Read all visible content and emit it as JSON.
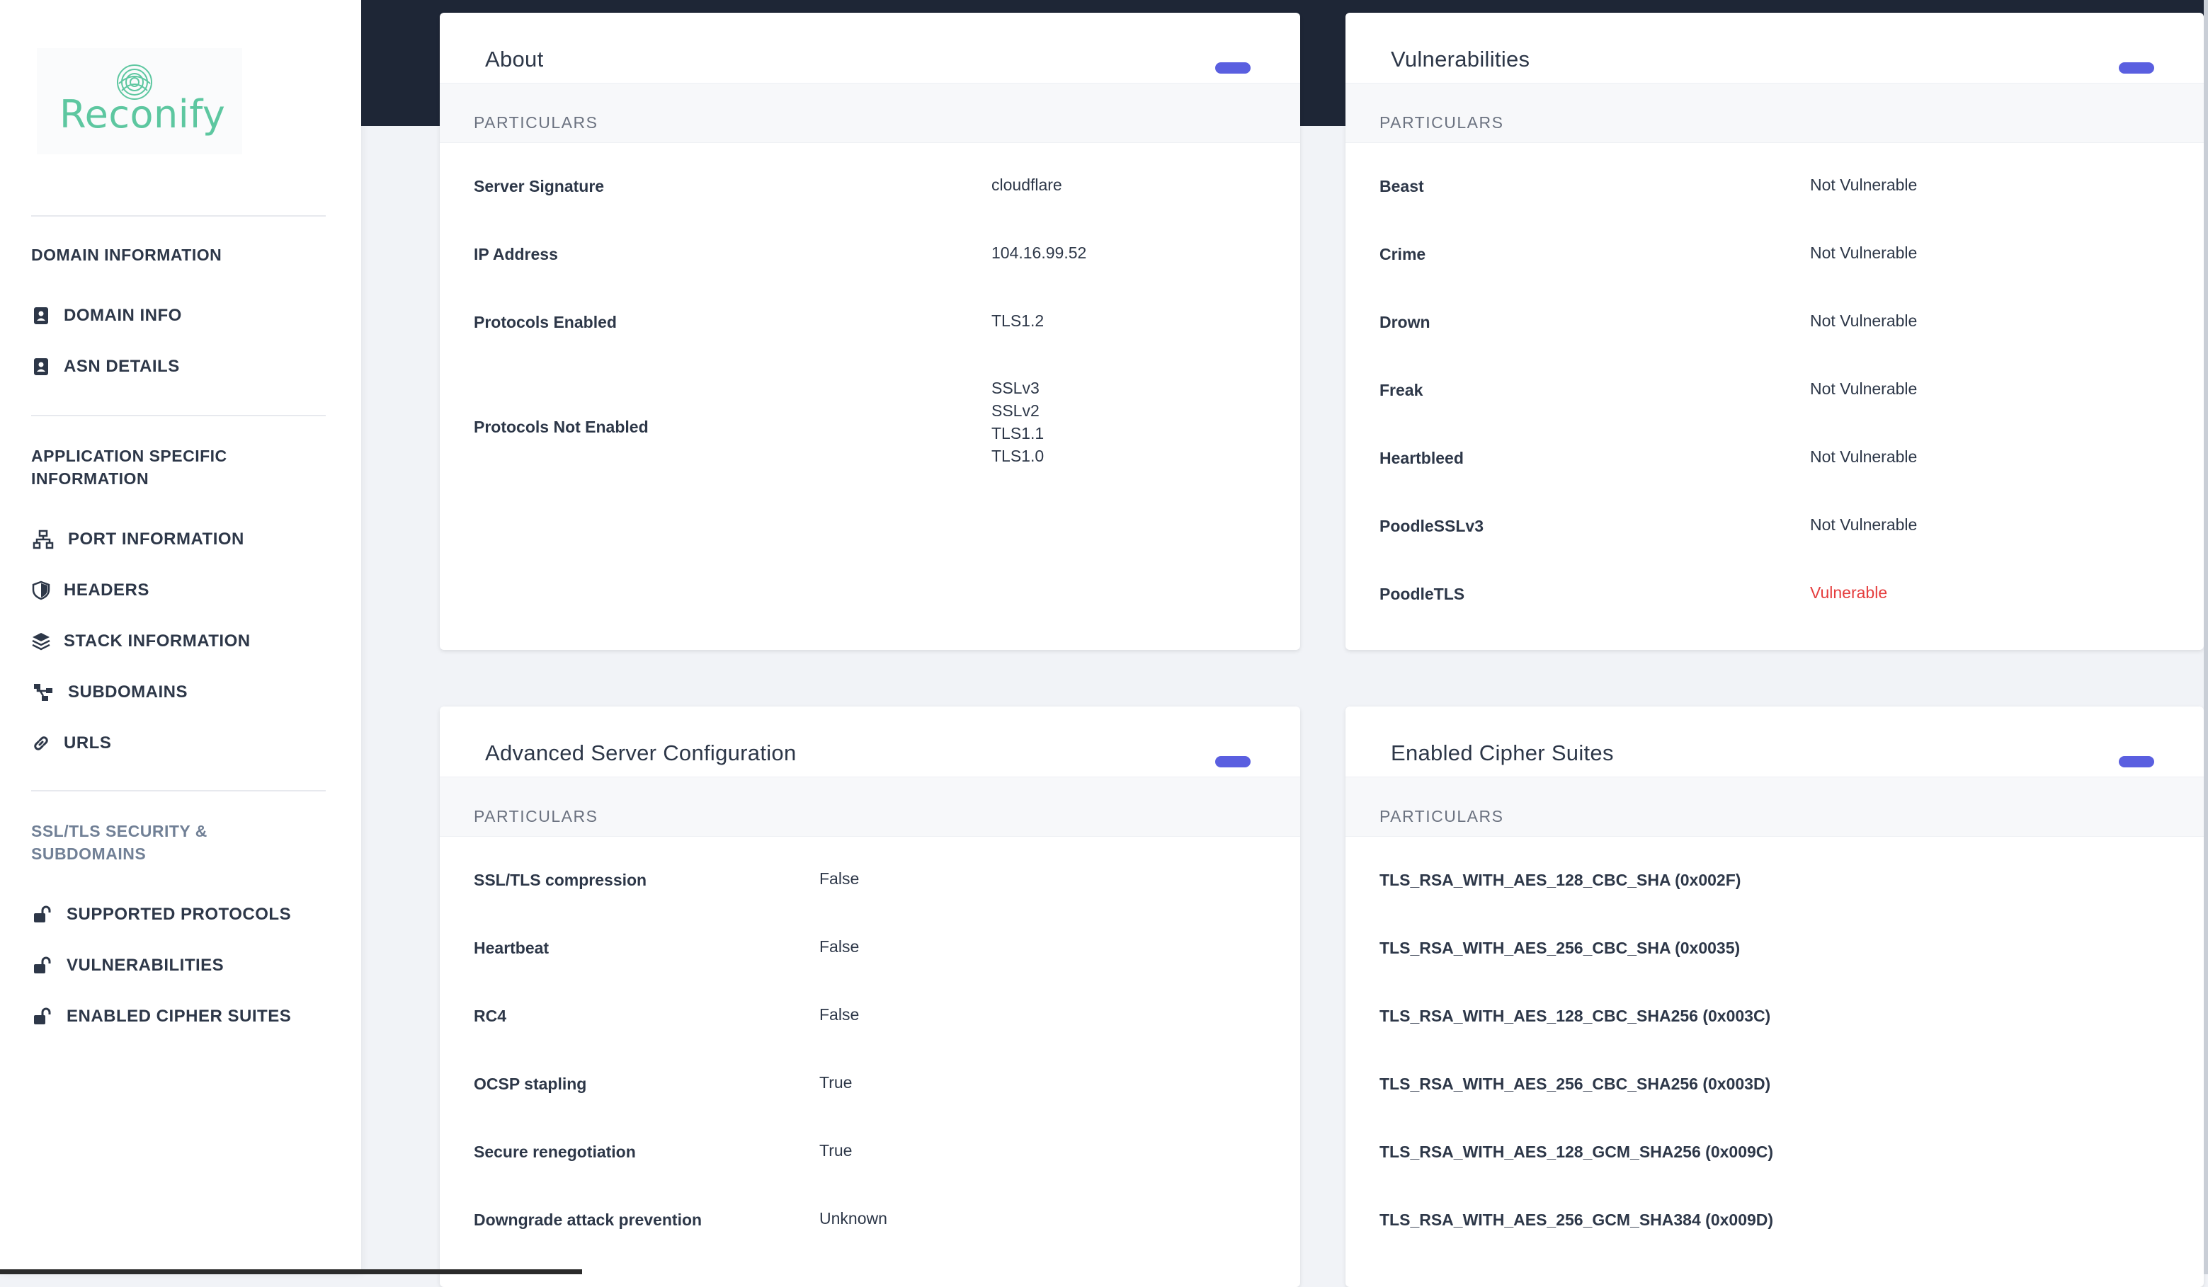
{
  "brand": {
    "name": "Reconify",
    "accent": "#5dc7a0"
  },
  "sidebar": {
    "sections": [
      {
        "title": "DOMAIN INFORMATION",
        "items": [
          {
            "label": "DOMAIN INFO",
            "icon": "id-card-icon"
          },
          {
            "label": "ASN DETAILS",
            "icon": "id-card-icon"
          }
        ]
      },
      {
        "title": "APPLICATION SPECIFIC INFORMATION",
        "items": [
          {
            "label": "PORT INFORMATION",
            "icon": "network-icon"
          },
          {
            "label": "HEADERS",
            "icon": "shield-icon"
          },
          {
            "label": "STACK INFORMATION",
            "icon": "layers-icon"
          },
          {
            "label": "SUBDOMAINS",
            "icon": "sitemap-icon"
          },
          {
            "label": "URLS",
            "icon": "link-icon"
          }
        ]
      },
      {
        "title": "SSL/TLS SECURITY & SUBDOMAINS",
        "items": [
          {
            "label": "SUPPORTED PROTOCOLS",
            "icon": "unlock-icon"
          },
          {
            "label": "VULNERABILITIES",
            "icon": "unlock-icon"
          },
          {
            "label": "ENABLED CIPHER SUITES",
            "icon": "unlock-icon"
          }
        ]
      }
    ]
  },
  "cards": {
    "about": {
      "title": "About",
      "particulars": "PARTICULARS",
      "rows": [
        {
          "key": "Server Signature",
          "value": [
            "cloudflare"
          ]
        },
        {
          "key": "IP Address",
          "value": [
            "104.16.99.52"
          ]
        },
        {
          "key": "Protocols Enabled",
          "value": [
            "TLS1.2"
          ]
        },
        {
          "key": "Protocols Not Enabled",
          "value": [
            "SSLv3",
            "SSLv2",
            "TLS1.1",
            "TLS1.0"
          ]
        }
      ]
    },
    "vulnerabilities": {
      "title": "Vulnerabilities",
      "particulars": "PARTICULARS",
      "rows": [
        {
          "key": "Beast",
          "value": "Not Vulnerable"
        },
        {
          "key": "Crime",
          "value": "Not Vulnerable"
        },
        {
          "key": "Drown",
          "value": "Not Vulnerable"
        },
        {
          "key": "Freak",
          "value": "Not Vulnerable"
        },
        {
          "key": "Heartbleed",
          "value": "Not Vulnerable"
        },
        {
          "key": "PoodleSSLv3",
          "value": "Not Vulnerable"
        },
        {
          "key": "PoodleTLS",
          "value": "Vulnerable"
        }
      ],
      "vulnerable_color": "#e53e3e"
    },
    "advanced": {
      "title": "Advanced Server Configuration",
      "particulars": "PARTICULARS",
      "rows": [
        {
          "key": "SSL/TLS compression",
          "value": "False"
        },
        {
          "key": "Heartbeat",
          "value": "False"
        },
        {
          "key": "RC4",
          "value": "False"
        },
        {
          "key": "OCSP stapling",
          "value": "True"
        },
        {
          "key": "Secure renegotiation",
          "value": "True"
        },
        {
          "key": "Downgrade attack prevention",
          "value": "Unknown"
        }
      ]
    },
    "ciphers": {
      "title": "Enabled Cipher Suites",
      "particulars": "PARTICULARS",
      "rows": [
        "TLS_RSA_WITH_AES_128_CBC_SHA (0x002F)",
        "TLS_RSA_WITH_AES_256_CBC_SHA (0x0035)",
        "TLS_RSA_WITH_AES_128_CBC_SHA256 (0x003C)",
        "TLS_RSA_WITH_AES_256_CBC_SHA256 (0x003D)",
        "TLS_RSA_WITH_AES_128_GCM_SHA256 (0x009C)",
        "TLS_RSA_WITH_AES_256_GCM_SHA384 (0x009D)"
      ]
    }
  },
  "colors": {
    "toggle": "#5a5fe0",
    "topband": "#1e2636"
  }
}
